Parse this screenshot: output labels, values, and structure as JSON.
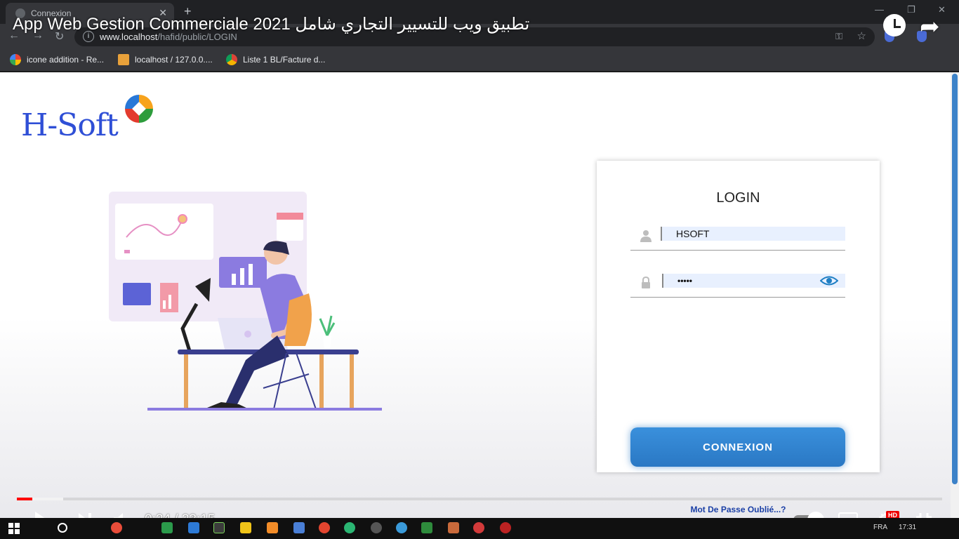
{
  "browser": {
    "tab_title": "Connexion",
    "url_host": "www.localhost",
    "url_path": "/hafid/public/LOGIN",
    "bookmarks": [
      {
        "label": "icone addition - Re..."
      },
      {
        "label": "localhost / 127.0.0...."
      },
      {
        "label": "Liste 1 BL/Facture d..."
      }
    ]
  },
  "video": {
    "title": "App Web Gestion Commerciale 2021 تطبيق ويب للتسيير التجاري شامل",
    "current_time": "0:24",
    "separator": "/",
    "duration": "23:15",
    "progress_fraction": 0.017,
    "buffered_fraction": 0.05,
    "hd_badge": "HD"
  },
  "page": {
    "logo_text": "H-Soft",
    "login": {
      "title": "LOGIN",
      "username_value": "HSOFT",
      "password_value": "•••••",
      "submit_label": "CONNEXION",
      "forgot_label": "Mot De Passe Oublié...?"
    }
  },
  "taskbar": {
    "lang": "FRA",
    "clock": "17:31"
  },
  "colors": {
    "accent": "#2a78c4",
    "logo": "#2f4fd6",
    "link": "#1a3fa6",
    "progress": "#ff0000"
  }
}
